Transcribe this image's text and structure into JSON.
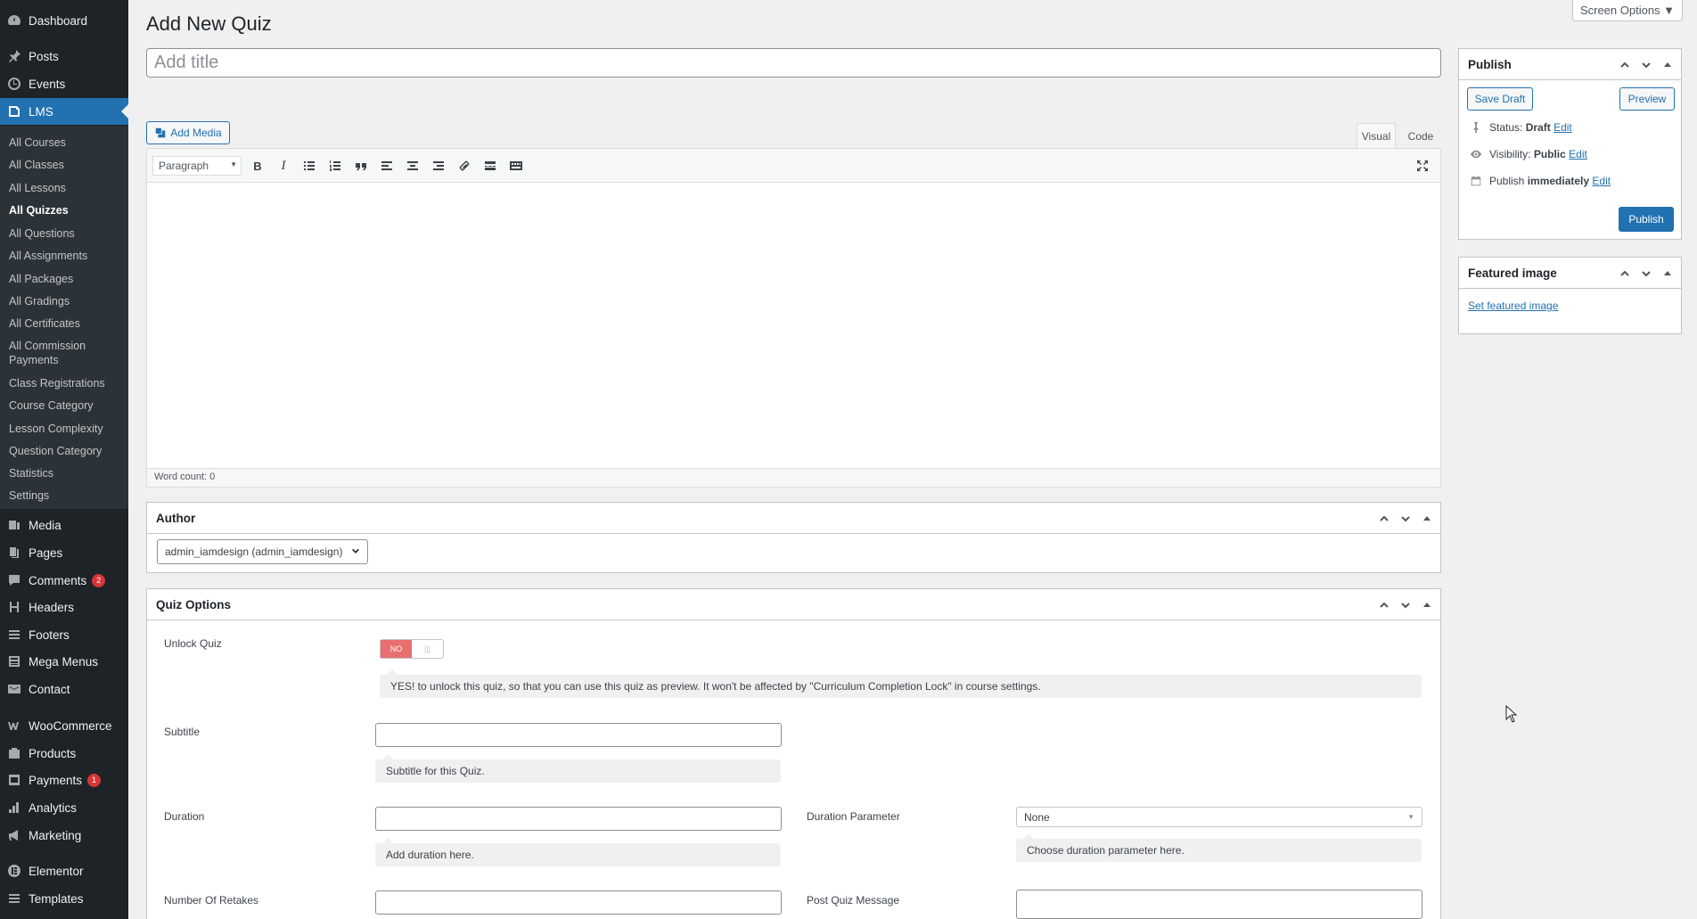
{
  "sidebar": {
    "top_items": [
      {
        "label": "Dashboard",
        "icon": "dashboard-icon"
      },
      {
        "label": "Posts",
        "icon": "pin-icon"
      },
      {
        "label": "Events",
        "icon": "clock-icon"
      },
      {
        "label": "LMS",
        "icon": "book-icon"
      }
    ],
    "lms_submenu": [
      "All Courses",
      "All Classes",
      "All Lessons",
      "All Quizzes",
      "All Questions",
      "All Assignments",
      "All Packages",
      "All Gradings",
      "All Certificates",
      "All Commission Payments",
      "Class Registrations",
      "Course Category",
      "Lesson Complexity",
      "Question Category",
      "Statistics",
      "Settings"
    ],
    "bottom_items": [
      {
        "label": "Media",
        "icon": "media-icon"
      },
      {
        "label": "Pages",
        "icon": "pages-icon"
      },
      {
        "label": "Comments",
        "icon": "comments-icon",
        "badge": "2"
      },
      {
        "label": "Headers",
        "icon": "header-icon"
      },
      {
        "label": "Footers",
        "icon": "footer-icon"
      },
      {
        "label": "Mega Menus",
        "icon": "menu-icon"
      },
      {
        "label": "Contact",
        "icon": "mail-icon"
      },
      {
        "label": "WooCommerce",
        "icon": "woo-icon"
      },
      {
        "label": "Products",
        "icon": "products-icon"
      },
      {
        "label": "Payments",
        "icon": "payments-icon",
        "badge": "1"
      },
      {
        "label": "Analytics",
        "icon": "analytics-icon"
      },
      {
        "label": "Marketing",
        "icon": "marketing-icon"
      },
      {
        "label": "Elementor",
        "icon": "elementor-icon"
      },
      {
        "label": "Templates",
        "icon": "templates-icon"
      }
    ]
  },
  "header": {
    "title": "Add New Quiz",
    "screen_options": "Screen Options ▼"
  },
  "editor": {
    "title_placeholder": "Add title",
    "add_media": "Add Media",
    "tab_visual": "Visual",
    "tab_code": "Code",
    "format_select": "Paragraph",
    "word_count": "Word count: 0"
  },
  "publish": {
    "title": "Publish",
    "save_draft": "Save Draft",
    "preview": "Preview",
    "status_label": "Status:",
    "status_value": "Draft",
    "visibility_label": "Visibility:",
    "visibility_value": "Public",
    "publish_label": "Publish",
    "publish_value": "immediately",
    "edit": "Edit",
    "publish_button": "Publish"
  },
  "featured": {
    "title": "Featured image",
    "link": "Set featured image"
  },
  "author": {
    "title": "Author",
    "selected": "admin_iamdesign (admin_iamdesign)"
  },
  "quiz_options": {
    "title": "Quiz Options",
    "unlock_label": "Unlock Quiz",
    "unlock_toggle": "NO",
    "unlock_hint": "YES! to unlock this quiz, so that you can use this quiz as preview. It won't be affected by \"Curriculum Completion Lock\" in course settings.",
    "subtitle_label": "Subtitle",
    "subtitle_hint": "Subtitle for this Quiz.",
    "duration_label": "Duration",
    "duration_hint": "Add duration here.",
    "duration_param_label": "Duration Parameter",
    "duration_param_value": "None",
    "duration_param_hint": "Choose duration parameter here.",
    "retakes_label": "Number Of Retakes",
    "post_quiz_label": "Post Quiz Message"
  },
  "colors": {
    "sidebar": "#1d2327",
    "accent": "#2271b1",
    "badge": "#d63638"
  }
}
